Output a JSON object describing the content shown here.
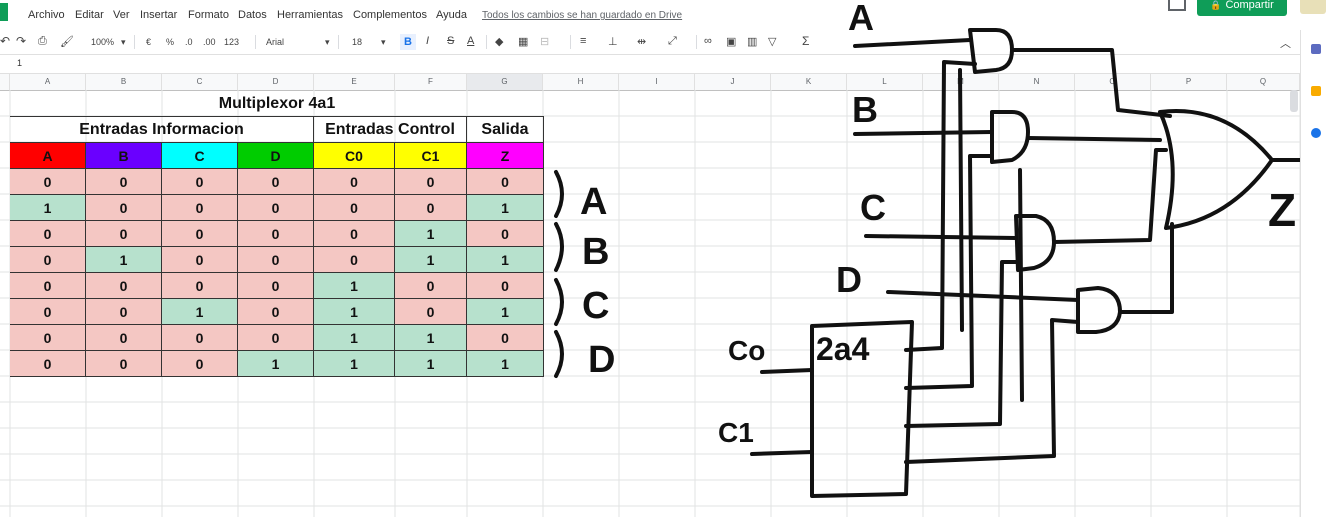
{
  "menu": {
    "items": [
      "Archivo",
      "Editar",
      "Ver",
      "Insertar",
      "Formato",
      "Datos",
      "Herramientas",
      "Complementos",
      "Ayuda"
    ],
    "saved_status": "Todos los cambios se han guardado en Drive",
    "share_label": "Compartir"
  },
  "toolbar": {
    "zoom": "100%",
    "currency": "€",
    "percent": "%",
    "dec_less": ".0",
    "dec_more": ".00",
    "format": "123",
    "font": "Arial",
    "size": "18",
    "bold": "B",
    "italic": "I",
    "strike": "S",
    "textcolor": "A",
    "sum": "Σ"
  },
  "formula_bar": {
    "value": "1"
  },
  "columns": [
    "A",
    "B",
    "C",
    "D",
    "E",
    "F",
    "G",
    "H",
    "I",
    "J",
    "K",
    "L",
    "M",
    "N",
    "O",
    "P",
    "Q"
  ],
  "table": {
    "title": "Multiplexor 4a1",
    "groups": [
      "Entradas Informacion",
      "Entradas Control",
      "Salida"
    ],
    "headers": [
      "A",
      "B",
      "C",
      "D",
      "C0",
      "C1",
      "Z"
    ],
    "header_colors": [
      "#ff0000",
      "#6a00ff",
      "#00ffff",
      "#00cc00",
      "#ffff00",
      "#ffff00",
      "#ff00ff"
    ],
    "rows": [
      [
        "0",
        "0",
        "0",
        "0",
        "0",
        "0",
        "0"
      ],
      [
        "1",
        "0",
        "0",
        "0",
        "0",
        "0",
        "1"
      ],
      [
        "0",
        "0",
        "0",
        "0",
        "0",
        "1",
        "0"
      ],
      [
        "0",
        "1",
        "0",
        "0",
        "0",
        "1",
        "1"
      ],
      [
        "0",
        "0",
        "0",
        "0",
        "1",
        "0",
        "0"
      ],
      [
        "0",
        "0",
        "1",
        "0",
        "1",
        "0",
        "1"
      ],
      [
        "0",
        "0",
        "0",
        "0",
        "1",
        "1",
        "0"
      ],
      [
        "0",
        "0",
        "0",
        "1",
        "1",
        "1",
        "1"
      ]
    ]
  },
  "drawing": {
    "brace_labels": [
      "A",
      "B",
      "C",
      "D"
    ],
    "inputs": [
      "A",
      "B",
      "C",
      "D"
    ],
    "controls": [
      "Co",
      "C1"
    ],
    "decoder_label": "2a4",
    "output": "Z"
  }
}
